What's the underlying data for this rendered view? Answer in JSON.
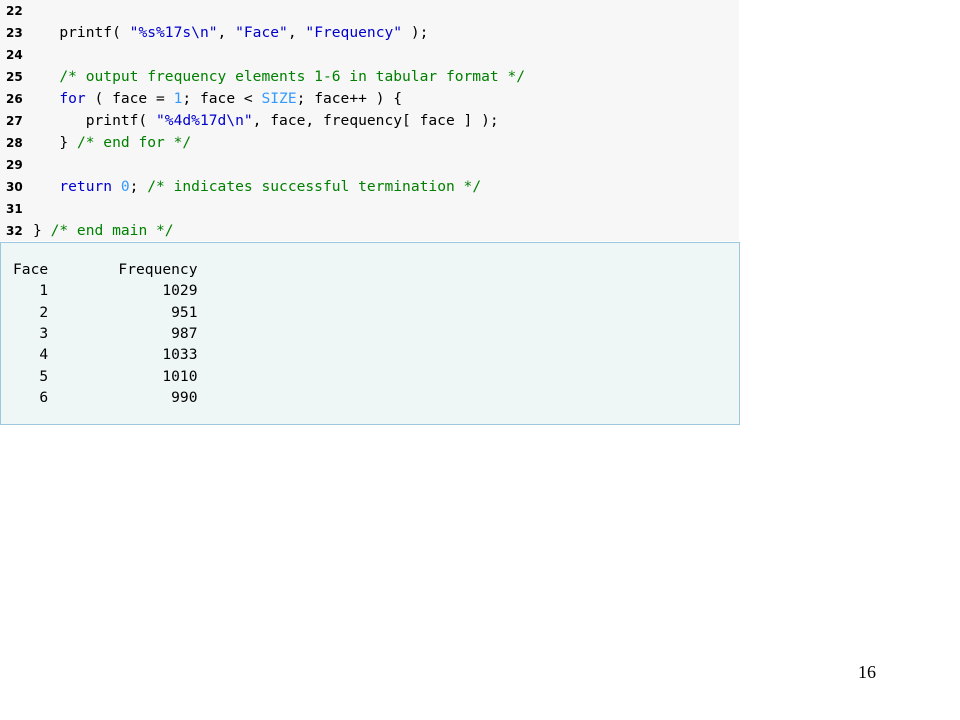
{
  "code": {
    "lines": [
      {
        "num": "22",
        "segments": []
      },
      {
        "num": "23",
        "segments": [
          {
            "t": "   printf( ",
            "c": "plain"
          },
          {
            "t": "\"%s%17s\\n\"",
            "c": "st"
          },
          {
            "t": ", ",
            "c": "plain"
          },
          {
            "t": "\"Face\"",
            "c": "st"
          },
          {
            "t": ", ",
            "c": "plain"
          },
          {
            "t": "\"Frequency\"",
            "c": "st"
          },
          {
            "t": " );",
            "c": "plain"
          }
        ]
      },
      {
        "num": "24",
        "segments": []
      },
      {
        "num": "25",
        "segments": [
          {
            "t": "   ",
            "c": "plain"
          },
          {
            "t": "/* output frequency elements 1-6 in tabular format */",
            "c": "cm"
          }
        ]
      },
      {
        "num": "26",
        "segments": [
          {
            "t": "   ",
            "c": "plain"
          },
          {
            "t": "for",
            "c": "kw"
          },
          {
            "t": " ( face = ",
            "c": "plain"
          },
          {
            "t": "1",
            "c": "num"
          },
          {
            "t": "; face < ",
            "c": "plain"
          },
          {
            "t": "SIZE",
            "c": "const"
          },
          {
            "t": "; face++ ) {",
            "c": "plain"
          }
        ]
      },
      {
        "num": "27",
        "segments": [
          {
            "t": "      printf( ",
            "c": "plain"
          },
          {
            "t": "\"%4d%17d\\n\"",
            "c": "st"
          },
          {
            "t": ", face, frequency[ face ] );",
            "c": "plain"
          }
        ]
      },
      {
        "num": "28",
        "segments": [
          {
            "t": "   } ",
            "c": "plain"
          },
          {
            "t": "/* end for */",
            "c": "cm"
          }
        ]
      },
      {
        "num": "29",
        "segments": []
      },
      {
        "num": "30",
        "segments": [
          {
            "t": "   ",
            "c": "plain"
          },
          {
            "t": "return",
            "c": "kw"
          },
          {
            "t": " ",
            "c": "plain"
          },
          {
            "t": "0",
            "c": "num"
          },
          {
            "t": "; ",
            "c": "plain"
          },
          {
            "t": "/* indicates successful termination */",
            "c": "cm"
          }
        ]
      },
      {
        "num": "31",
        "segments": []
      },
      {
        "num": "32",
        "segments": [
          {
            "t": "} ",
            "c": "plain"
          },
          {
            "t": "/* end main */",
            "c": "cm"
          }
        ]
      }
    ]
  },
  "output": {
    "lines": [
      "Face        Frequency",
      "   1             1029",
      "   2              951",
      "   3              987",
      "   4             1033",
      "   5             1010",
      "   6              990"
    ]
  },
  "page_number": "16"
}
